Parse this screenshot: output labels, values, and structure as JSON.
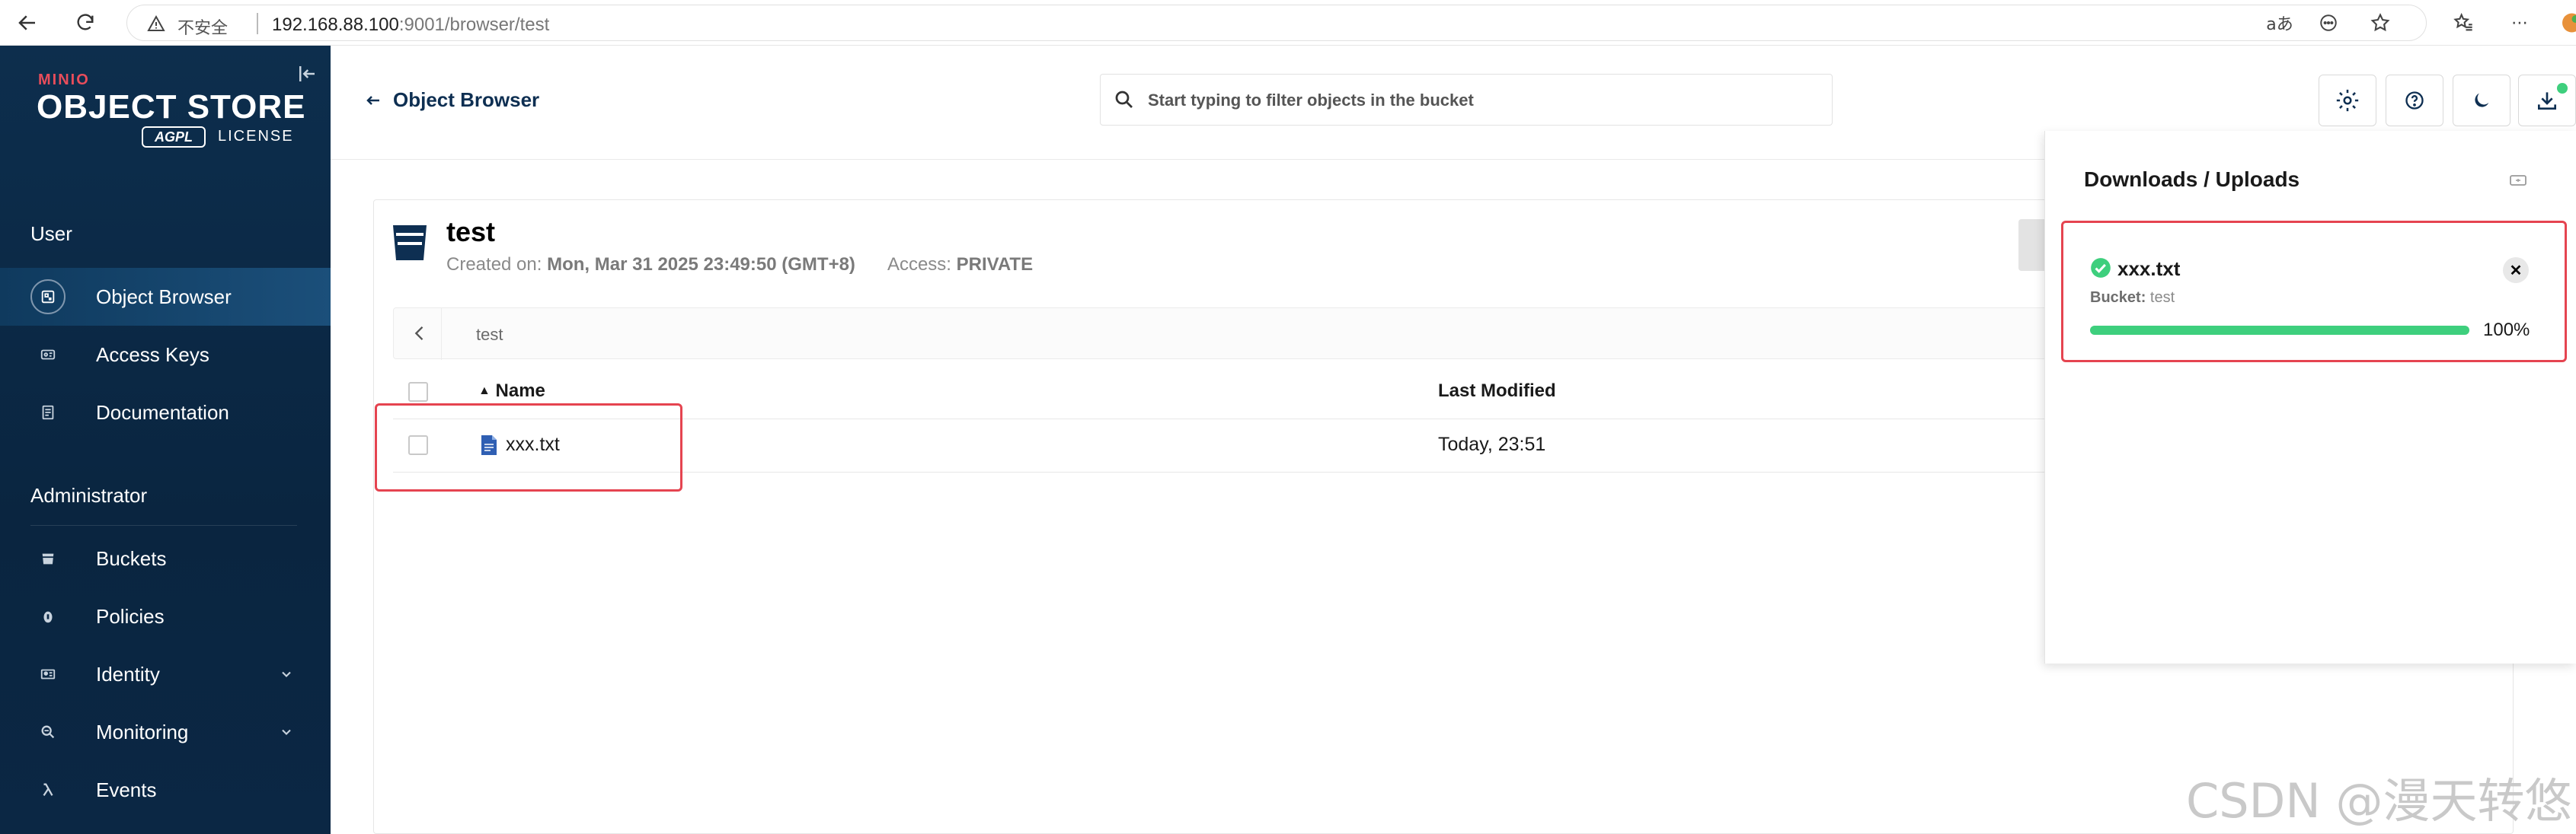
{
  "browser": {
    "security_label": "不安全",
    "url_host": "192.168.88.100",
    "url_rest": ":9001/browser/test"
  },
  "sidebar": {
    "logo_brand": "MINIO",
    "logo_title": "OBJECT STORE",
    "logo_badge": "AGPL",
    "logo_license": "LICENSE",
    "sections": [
      {
        "title": "User"
      },
      {
        "title": "Administrator"
      }
    ],
    "user_items": [
      {
        "label": "Object Browser",
        "icon": "object-browser-icon",
        "active": true
      },
      {
        "label": "Access Keys",
        "icon": "key-icon"
      },
      {
        "label": "Documentation",
        "icon": "document-icon"
      }
    ],
    "admin_items": [
      {
        "label": "Buckets",
        "icon": "bucket-icon"
      },
      {
        "label": "Policies",
        "icon": "lock-icon"
      },
      {
        "label": "Identity",
        "icon": "id-card-icon",
        "expandable": true
      },
      {
        "label": "Monitoring",
        "icon": "search-icon",
        "expandable": true
      },
      {
        "label": "Events",
        "icon": "lambda-icon"
      }
    ]
  },
  "header": {
    "back_label": "Object Browser",
    "search_placeholder": "Start typing to filter objects in the bucket"
  },
  "bucket": {
    "name": "test",
    "created_label": "Created on:",
    "created_value": "Mon, Mar 31 2025 23:49:50 (GMT+8)",
    "access_label": "Access:",
    "access_value": "PRIVATE",
    "breadcrumb": "test"
  },
  "table": {
    "columns": [
      "Name",
      "Last Modified"
    ],
    "sort_indicator": "▲",
    "rows": [
      {
        "name": "xxx.txt",
        "last_modified": "Today, 23:51"
      }
    ]
  },
  "downloads": {
    "title": "Downloads / Uploads",
    "items": [
      {
        "name": "xxx.txt",
        "bucket_label": "Bucket:",
        "bucket_value": "test",
        "progress": 100,
        "progress_label": "100%"
      }
    ]
  },
  "colors": {
    "sidebar_bg": "#0a2540",
    "accent": "#0e2f52",
    "success": "#3ecf7d",
    "highlight": "#e54450"
  },
  "watermark": "CSDN @漫天转悠"
}
